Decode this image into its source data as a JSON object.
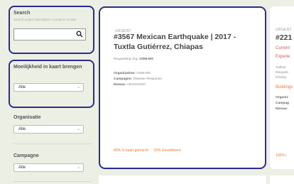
{
  "search": {
    "label": "Search",
    "hint": "Search project description or project number",
    "value": ""
  },
  "filters": [
    {
      "label": "Moeilijkheid in kaart brengen",
      "value": "Alle"
    },
    {
      "label": "Organisatie",
      "value": "Alle"
    },
    {
      "label": "Campagne",
      "value": "Alle"
    }
  ],
  "main_card": {
    "badge": "URGENT",
    "title": "#3567 Mexican Earthquake | 2017 - Tuxtla Gutiérrez, Chiapas",
    "requesting_label": "Requesting Org:",
    "requesting_value": "OSM-MX",
    "organization_label": "Organization:",
    "organization_value": "OSM-MX",
    "campaign_label": "Campagne:",
    "campaign_value": "Disaster Response",
    "level_label": "Niveau:",
    "level_value": "ADVANCED",
    "mapped_pct": "40%",
    "mapped_label": "In kaart gebracht",
    "validated_pct": "32%",
    "validated_label": "Gevalideerd"
  },
  "second_card": {
    "badge": "URGENT",
    "title_fragment": "#221",
    "line1": "Current",
    "line2": "Experie",
    "line3": "Author:",
    "line4": "Request",
    "line5": "Priority:",
    "line6": "Buildings",
    "line7": "Organiz",
    "line8": "Campag",
    "line9": "Niveau:",
    "pct": "100% i"
  },
  "colors": {
    "highlight": "#2a2d8c",
    "accent": "#e87b35",
    "background": "#ecefe4"
  }
}
